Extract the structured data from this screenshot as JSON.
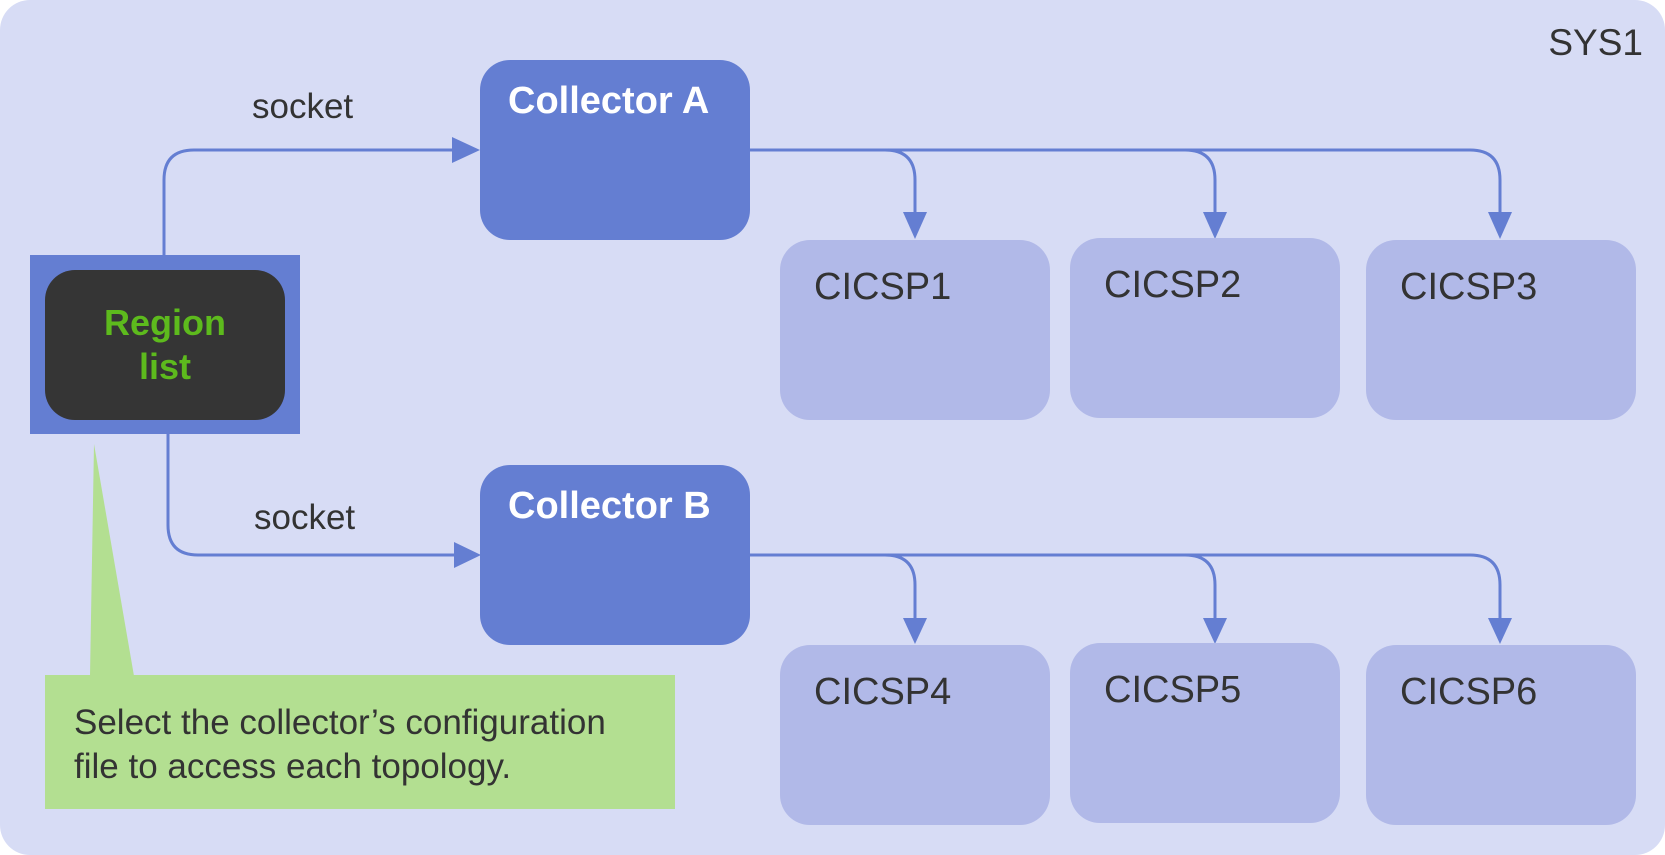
{
  "diagram": {
    "system_label": "SYS1",
    "region_list": {
      "label": "Region\nlist"
    },
    "connections": [
      {
        "label": "socket",
        "from": "Region list",
        "to": "Collector A"
      },
      {
        "label": "socket",
        "from": "Region list",
        "to": "Collector B"
      }
    ],
    "collectors": [
      {
        "label": "Collector A",
        "regions": [
          "CICSP1",
          "CICSP2",
          "CICSP3"
        ]
      },
      {
        "label": "Collector B",
        "regions": [
          "CICSP4",
          "CICSP5",
          "CICSP6"
        ]
      }
    ],
    "regions": [
      "CICSP1",
      "CICSP2",
      "CICSP3",
      "CICSP4",
      "CICSP5",
      "CICSP6"
    ],
    "callout": {
      "text": "Select the collector’s configuration file to access each topology."
    },
    "colors": {
      "background": "#d7dcf5",
      "collector": "#647ed2",
      "region_box": "#b1b9e8",
      "region_list_bg": "#353535",
      "region_list_text": "#5dba1d",
      "callout": "#b3df91",
      "connector": "#647ed2",
      "text": "#333333"
    }
  }
}
